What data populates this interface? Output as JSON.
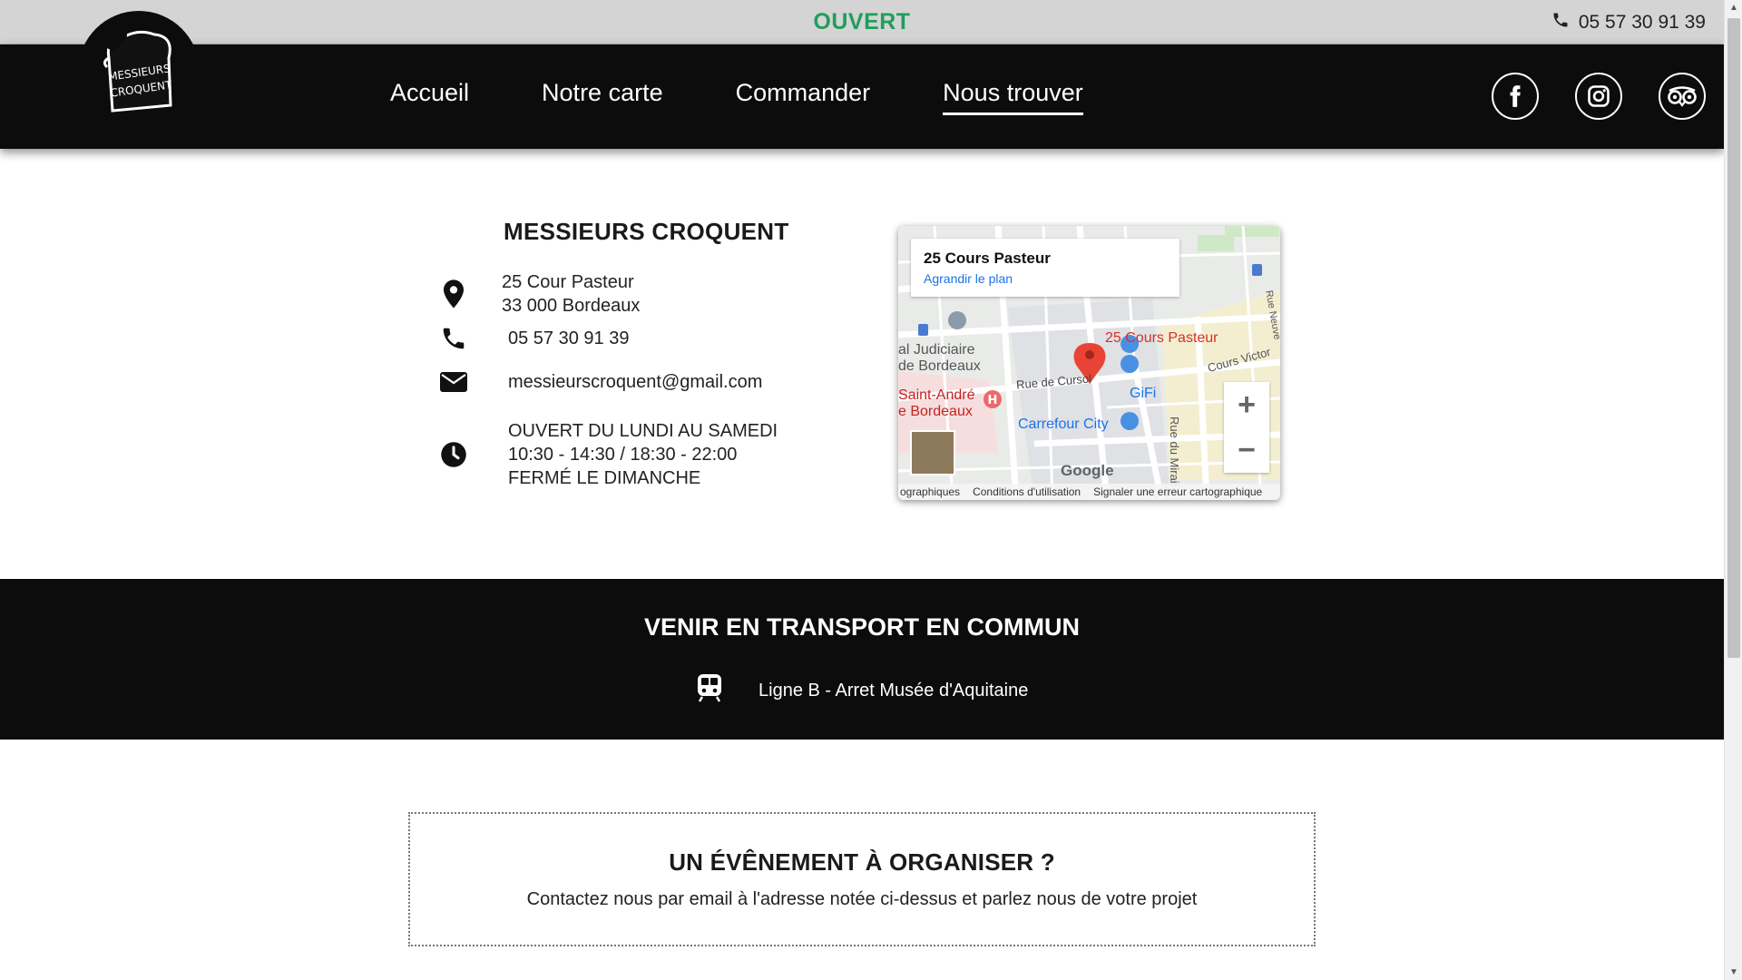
{
  "topbar": {
    "status": "OUVERT",
    "phone": "05 57 30 91 39"
  },
  "logo": {
    "text_line1": "MESSIEURS",
    "text_line2": "CROQUENT"
  },
  "nav": {
    "items": [
      "Accueil",
      "Notre carte",
      "Commander",
      "Nous trouver"
    ],
    "active": "Nous trouver"
  },
  "socials": [
    "facebook-icon",
    "instagram-icon",
    "tripadvisor-icon"
  ],
  "contact": {
    "name": "MESSIEURS CROQUENT",
    "address_line1": "25 Cour Pasteur",
    "address_line2": "33 000 Bordeaux",
    "phone": "05 57 30 91 39",
    "email": "messieurscroquent@gmail.com",
    "hours_line1": "OUVERT DU LUNDI AU SAMEDI",
    "hours_line2": "10:30 - 14:30 / 18:30 - 22:00",
    "hours_line3": "FERMÉ LE DIMANCHE"
  },
  "map": {
    "place": "25 Cours Pasteur",
    "enlarge": "Agrandir le plan",
    "pin_label": "25 Cours Pasteur",
    "labels": {
      "tribunal1": "al Judiciaire",
      "tribunal2": "de Bordeaux",
      "hospital1": "Saint-André",
      "hospital2": "e Bordeaux",
      "cursol": "Rue de Cursol",
      "gifi": "GiFi",
      "carrefour": "Carrefour City",
      "mirail": "Rue du Mirail",
      "victor": "Cours Victor",
      "neuve": "Rue Neuve",
      "google": "Google"
    },
    "footer": [
      "ographiques",
      "Conditions d'utilisation",
      "Signaler une erreur cartographique"
    ],
    "zoom_in": "+",
    "zoom_out": "−"
  },
  "transport": {
    "heading": "VENIR EN TRANSPORT EN COMMUN",
    "line": "Ligne B - Arret Musée d'Aquitaine"
  },
  "event": {
    "heading": "UN ÉVÊNEMENT À ORGANISER ?",
    "text": "Contactez nous par email à l'adresse notée ci-dessus et parlez nous de votre projet"
  },
  "colors": {
    "status_green": "#1f9e5c",
    "dark": "#0c0c0c",
    "map_pin": "#ea4335",
    "map_link": "#1a73e8"
  }
}
